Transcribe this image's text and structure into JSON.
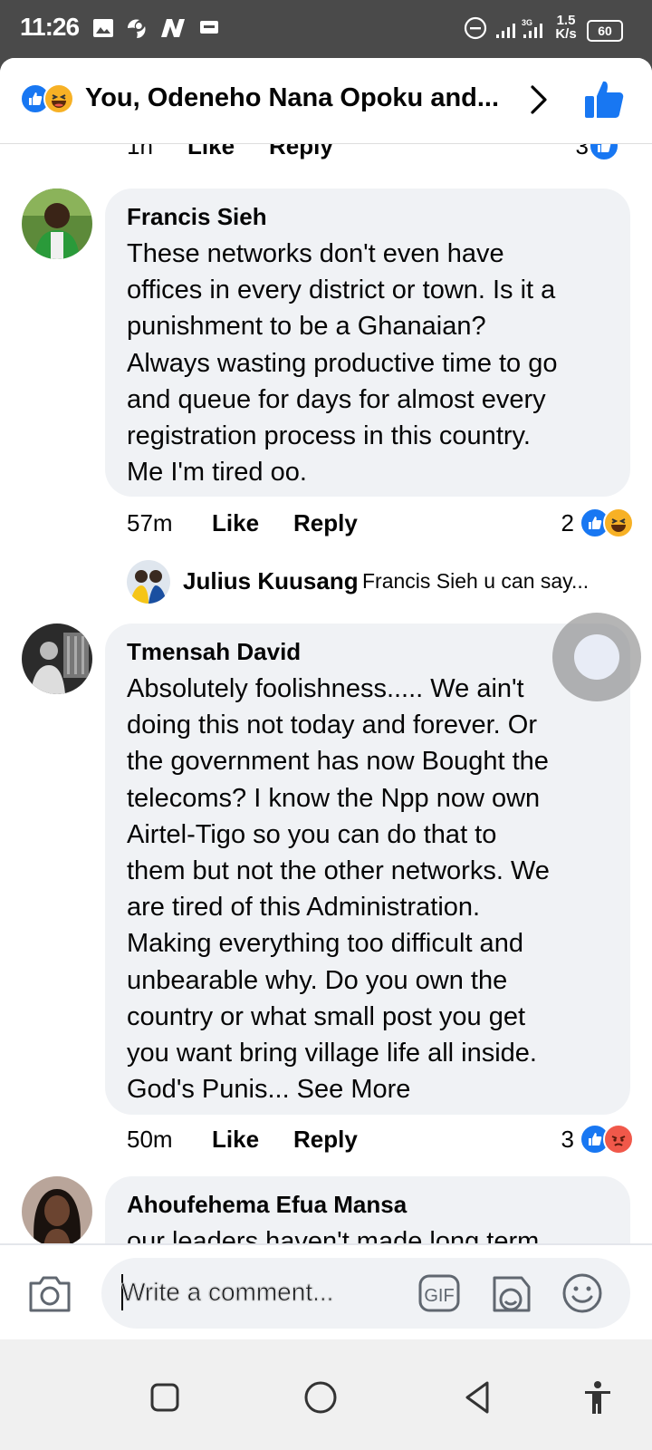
{
  "status_bar": {
    "time": "11:26",
    "network_speed_top": "1.5",
    "network_speed_bottom": "K/s",
    "network_type": "3G",
    "battery": "60"
  },
  "header": {
    "title": "You, Odeneho Nana Opoku and...",
    "reaction_icons": [
      "like-icon",
      "haha-icon"
    ]
  },
  "previous_comment_meta": {
    "time": "1h",
    "like": "Like",
    "reply": "Reply",
    "count": "3"
  },
  "comments": [
    {
      "author": "Francis Sieh",
      "text": "These networks don't even have\noffices in every district or town. Is it a\npunishment to be a Ghanaian?\nAlways wasting productive time to go\nand queue for days for almost every\nregistration process in this country.\nMe I'm tired oo.",
      "time": "57m",
      "like": "Like",
      "reply": "Reply",
      "reaction_count": "2",
      "reactions": [
        "like",
        "haha"
      ],
      "reply_preview": {
        "author": "Julius Kuusang",
        "text": "Francis Sieh u can say..."
      }
    },
    {
      "author": "Tmensah David",
      "text": "Absolutely foolishness..... We ain't\ndoing this not today and forever. Or\nthe government has now Bought the\ntelecoms?  I know the Npp now own\nAirtel-Tigo so you can do that to\nthem but not the other networks. We\nare tired of this Administration.\nMaking everything too difficult and\nunbearable why. Do you own the\ncountry or what small post you get\nyou want bring village life all inside.\nGod's Punis... See More",
      "time": "50m",
      "like": "Like",
      "reply": "Reply",
      "reaction_count": "3",
      "reactions": [
        "like",
        "angry"
      ]
    },
    {
      "author": "Ahoufehema Efua Mansa",
      "text": "our leaders haven't made long term"
    }
  ],
  "composer": {
    "placeholder": "Write a comment...",
    "gif_label": "GIF"
  },
  "colors": {
    "like_blue": "#1877f2",
    "bubble_bg": "#f0f2f5",
    "status_bar_bg": "#4a4a4a"
  }
}
